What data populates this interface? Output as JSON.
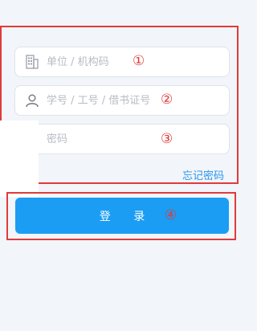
{
  "form": {
    "institution": {
      "placeholder": "单位 / 机构码",
      "marker": "①"
    },
    "account": {
      "placeholder": "学号 / 工号 / 借书证号",
      "marker": "②"
    },
    "password": {
      "placeholder": "密码",
      "marker": "③"
    },
    "forgot_password": "忘记密码"
  },
  "login": {
    "label": "登 录",
    "marker": "④"
  },
  "colors": {
    "accent": "#1b9df3",
    "highlight_box": "#e03b3b",
    "link": "#2a96f0"
  },
  "icons": {
    "institution": "building-icon",
    "account": "user-icon",
    "password": "lock-icon"
  }
}
